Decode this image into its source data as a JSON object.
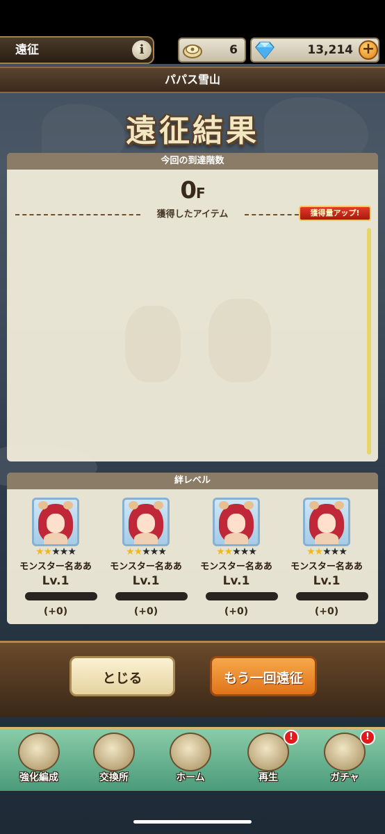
{
  "header": {
    "title": "遠征",
    "info_icon": "info-icon",
    "tickets": "6",
    "gems": "13,214",
    "plus_label": "+"
  },
  "stage": {
    "name": "パパス雪山"
  },
  "result": {
    "title": "遠征結果"
  },
  "floor": {
    "heading": "今回の到達階数",
    "value": "0",
    "unit": "F"
  },
  "items": {
    "label": "獲得したアイテム",
    "badge": "獲得量アップ!"
  },
  "bond": {
    "heading": "絆レベル",
    "monsters": [
      {
        "name": "モンスター名ああ",
        "level": "Lv.1",
        "gain": "(+0)",
        "stars": 2,
        "max_stars": 5
      },
      {
        "name": "モンスター名ああ",
        "level": "Lv.1",
        "gain": "(+0)",
        "stars": 2,
        "max_stars": 5
      },
      {
        "name": "モンスター名ああ",
        "level": "Lv.1",
        "gain": "(+0)",
        "stars": 2,
        "max_stars": 5
      },
      {
        "name": "モンスター名ああ",
        "level": "Lv.1",
        "gain": "(+0)",
        "stars": 2,
        "max_stars": 5
      }
    ]
  },
  "actions": {
    "close": "とじる",
    "retry": "もう一回遠征"
  },
  "nav": {
    "items": [
      {
        "label": "強化編成",
        "icon": "enhance-icon",
        "alert": false
      },
      {
        "label": "交換所",
        "icon": "shop-icon",
        "alert": false
      },
      {
        "label": "ホーム",
        "icon": "home-icon",
        "alert": false
      },
      {
        "label": "再生",
        "icon": "crystal-icon",
        "alert": true
      },
      {
        "label": "ガチャ",
        "icon": "gacha-icon",
        "alert": true
      }
    ],
    "alert_mark": "!"
  }
}
